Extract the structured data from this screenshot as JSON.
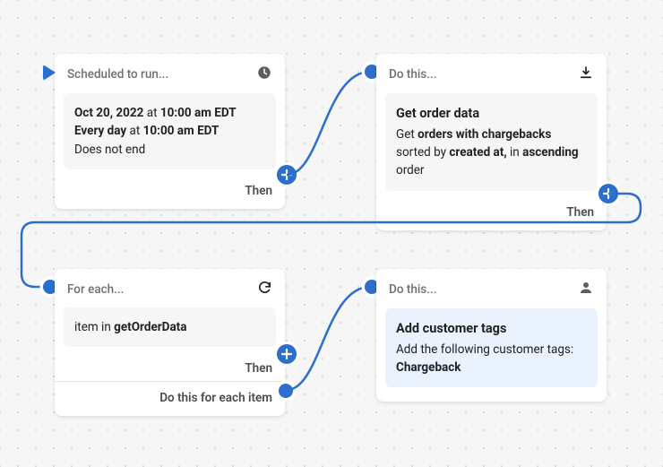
{
  "card1": {
    "title": "Scheduled to run...",
    "line1_pre": "Oct 20, 2022",
    "line1_mid": " at ",
    "line1_bold2": "10:00 am EDT",
    "line2_pre": "Every day",
    "line2_mid": " at ",
    "line2_bold2": "10:00 am EDT",
    "line3": "Does not end",
    "then": "Then"
  },
  "card2": {
    "title": "Do this...",
    "heading": "Get order data",
    "l1_a": "Get ",
    "l1_b": "orders with chargebacks",
    "l2_a": " sorted by ",
    "l2_b": "created at,",
    "l2_c": " in ",
    "l3_a": "ascending",
    "l3_b": " order",
    "then": "Then"
  },
  "card3": {
    "title": "For each...",
    "body_a": "item in ",
    "body_b": "getOrderData",
    "then": "Then",
    "loop": "Do this for each item"
  },
  "card4": {
    "title": "Do this...",
    "heading": "Add customer tags",
    "l1": "Add the following customer tags:",
    "l2": "Chargeback"
  }
}
